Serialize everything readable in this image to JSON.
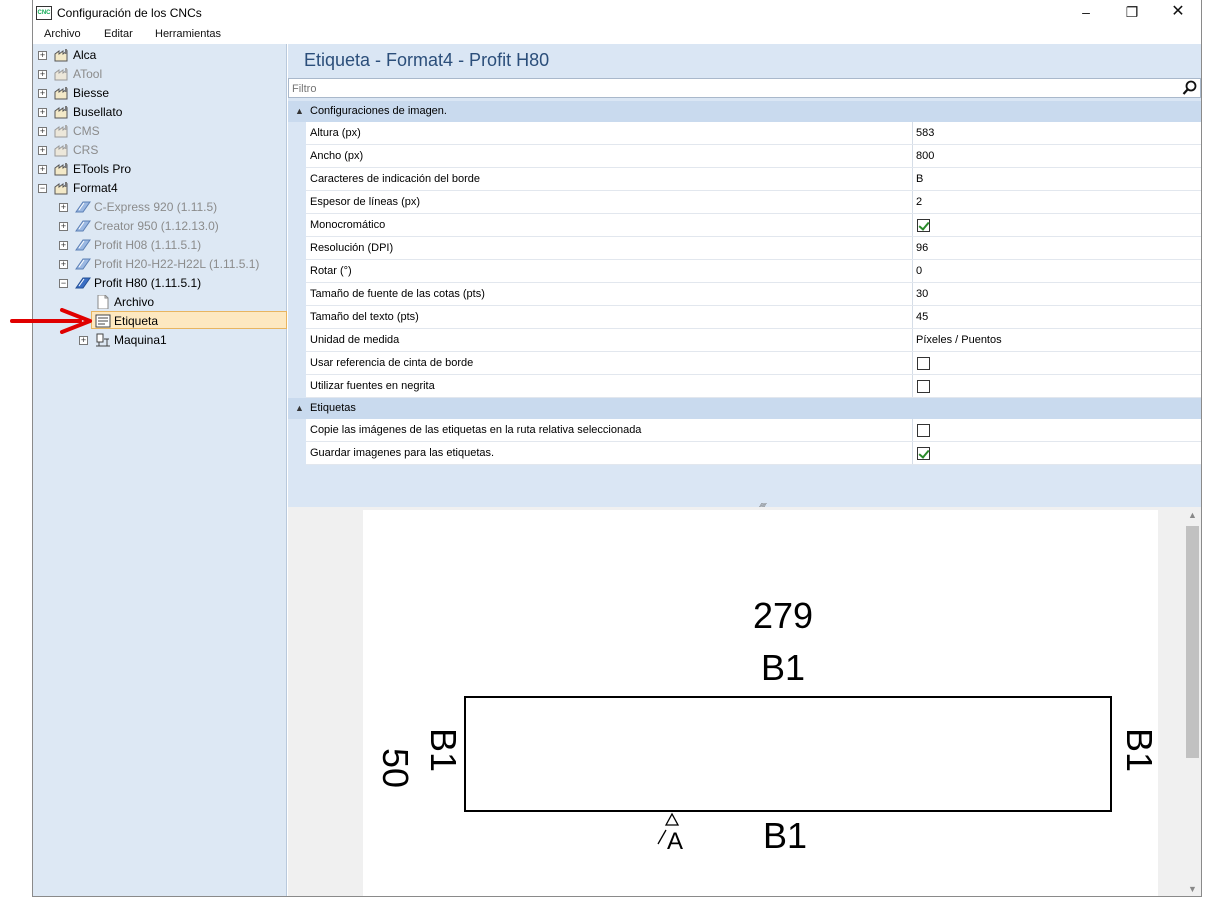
{
  "window": {
    "title": "Configuración de los CNCs",
    "app_icon_text": "CNC"
  },
  "window_buttons": {
    "minimize": "–",
    "maximize": "❐",
    "close": "✕"
  },
  "menu": [
    "Archivo",
    "Editar",
    "Herramientas"
  ],
  "tree": {
    "alca": "Alca",
    "atool": "ATool",
    "biesse": "Biesse",
    "busellato": "Busellato",
    "cms": "CMS",
    "crs": "CRS",
    "etools": "ETools Pro",
    "format4": "Format4",
    "cexpress": "C-Express 920 (1.11.5)",
    "creator": "Creator 950 (1.12.13.0)",
    "h08": "Profit H08 (1.11.5.1)",
    "h20": "Profit H20-H22-H22L (1.11.5.1)",
    "h80": "Profit H80 (1.11.5.1)",
    "archivo": "Archivo",
    "etiqueta": "Etiqueta",
    "maquina": "Maquina1"
  },
  "panel": {
    "heading": "Etiqueta - Format4 - Profit H80",
    "filter_placeholder": "Filtro"
  },
  "categories": {
    "imagen": "Configuraciones de imagen.",
    "etiquetas": "Etiquetas"
  },
  "props": {
    "altura": {
      "name": "Altura (px)",
      "value": "583"
    },
    "ancho": {
      "name": "Ancho (px)",
      "value": "800"
    },
    "caracteres": {
      "name": "Caracteres de indicación del borde",
      "value": "B"
    },
    "espesor": {
      "name": "Espesor de líneas (px)",
      "value": "2"
    },
    "mono": {
      "name": "Monocromático",
      "checked": true
    },
    "resolucion": {
      "name": "Resolución (DPI)",
      "value": "96"
    },
    "rotar": {
      "name": "Rotar (°)",
      "value": "0"
    },
    "fuente_cotas": {
      "name": "Tamaño de fuente de las cotas (pts)",
      "value": "30"
    },
    "tamano_texto": {
      "name": "Tamaño del texto (pts)",
      "value": "45"
    },
    "unidad": {
      "name": "Unidad de medida",
      "value": "Píxeles / Puentos"
    },
    "usar_ref": {
      "name": "Usar referencia de cinta de borde",
      "checked": false
    },
    "negrita": {
      "name": "Utilizar fuentes en negrita",
      "checked": false
    },
    "copie": {
      "name": "Copie las imágenes de las etiquetas en la ruta relativa seleccionada",
      "checked": false
    },
    "guardar": {
      "name": "Guardar imagenes para las etiquetas.",
      "checked": true
    }
  },
  "preview": {
    "top_dim": "279",
    "top_edge": "B1",
    "left_dim": "50",
    "left_edge": "B1",
    "right_edge": "B1",
    "bottom_edge": "B1",
    "grain_letter": "A"
  }
}
